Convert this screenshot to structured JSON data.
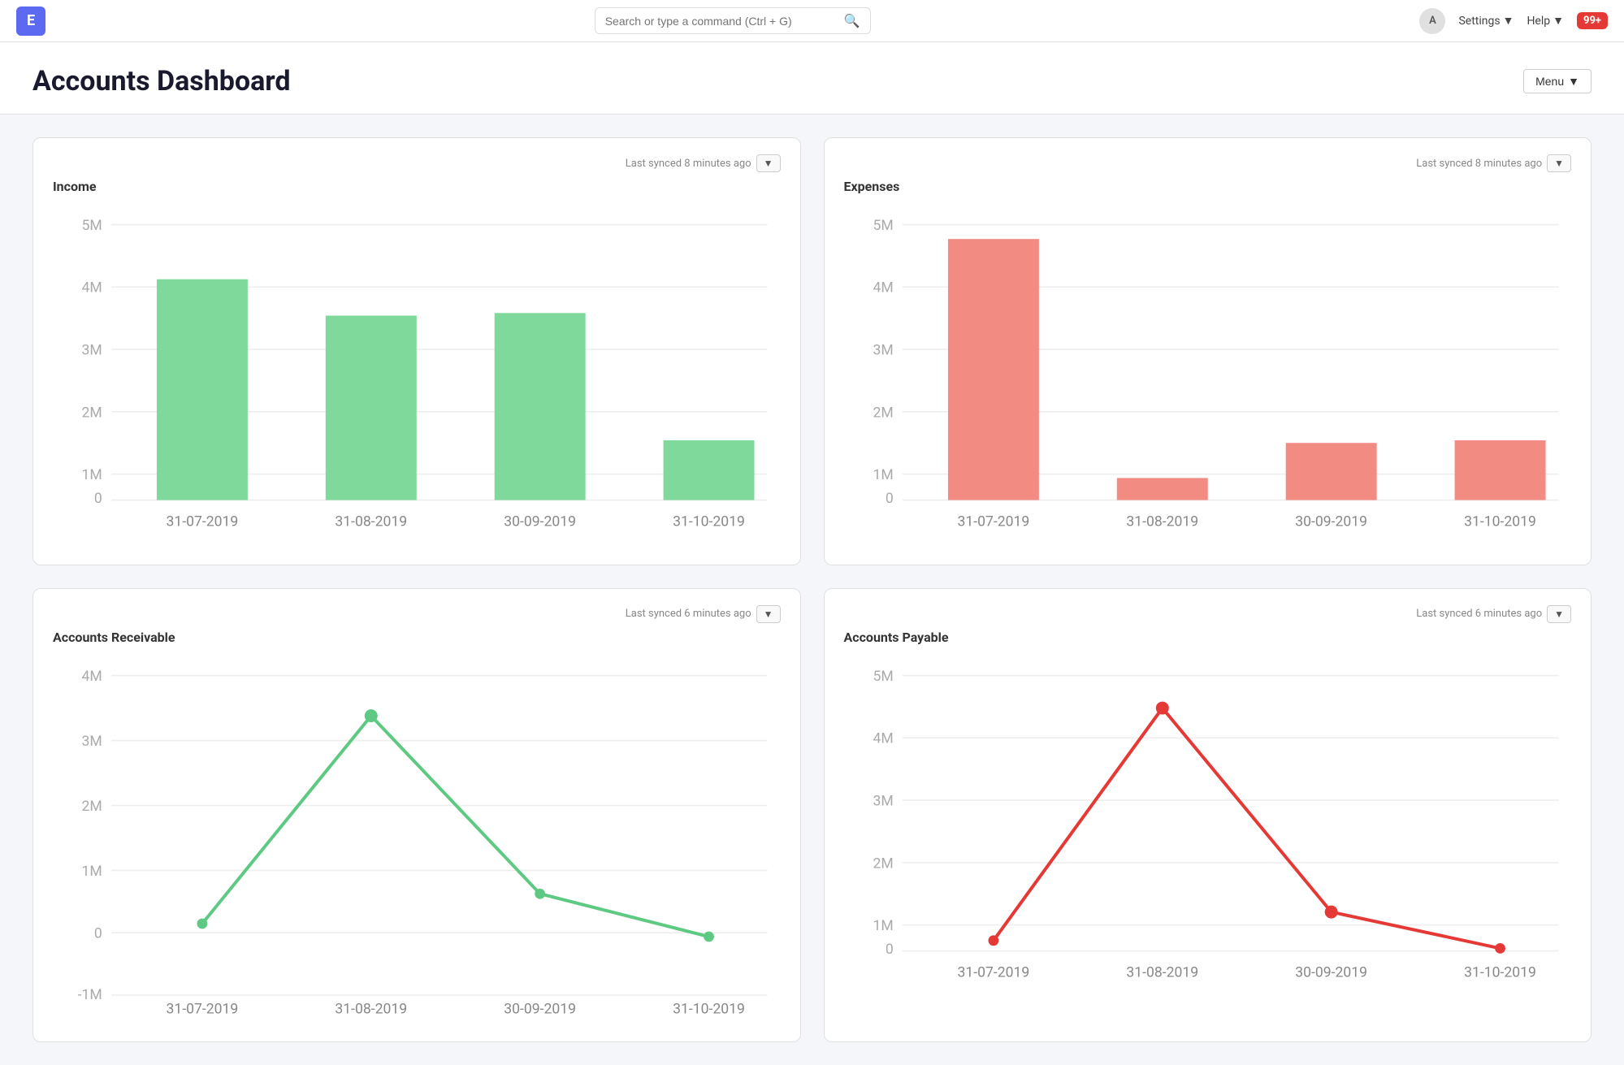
{
  "navbar": {
    "logo_letter": "E",
    "search_placeholder": "Search or type a command (Ctrl + G)",
    "avatar_letter": "A",
    "settings_label": "Settings",
    "help_label": "Help",
    "badge": "99+"
  },
  "page": {
    "title": "Accounts Dashboard",
    "menu_label": "Menu"
  },
  "income_chart": {
    "title": "Income",
    "sync_label": "Last synced 8 minutes ago",
    "dates": [
      "31-07-2019",
      "31-08-2019",
      "30-09-2019",
      "31-10-2019"
    ],
    "values": [
      4000000,
      3350000,
      3400000,
      1100000
    ],
    "y_labels": [
      "5M",
      "4M",
      "3M",
      "2M",
      "1M",
      "0"
    ],
    "color": "#7ed99a"
  },
  "expenses_chart": {
    "title": "Expenses",
    "sync_label": "Last synced 8 minutes ago",
    "dates": [
      "31-07-2019",
      "31-08-2019",
      "30-09-2019",
      "31-10-2019"
    ],
    "values": [
      4750000,
      400000,
      1050000,
      1100000
    ],
    "y_labels": [
      "5M",
      "4M",
      "3M",
      "2M",
      "1M",
      "0"
    ],
    "color": "#f28b82"
  },
  "receivable_chart": {
    "title": "Accounts Receivable",
    "sync_label": "Last synced 6 minutes ago",
    "dates": [
      "31-07-2019",
      "31-08-2019",
      "30-09-2019",
      "31-10-2019"
    ],
    "values": [
      150000,
      3350000,
      600000,
      -50000
    ],
    "y_labels": [
      "4M",
      "3M",
      "2M",
      "1M",
      "0",
      "-1M"
    ],
    "color": "#5ec982"
  },
  "payable_chart": {
    "title": "Accounts Payable",
    "sync_label": "Last synced 6 minutes ago",
    "dates": [
      "31-07-2019",
      "31-08-2019",
      "30-09-2019",
      "31-10-2019"
    ],
    "values": [
      200000,
      4400000,
      700000,
      50000
    ],
    "y_labels": [
      "5M",
      "4M",
      "3M",
      "2M",
      "1M",
      "0"
    ],
    "color": "#e53935"
  }
}
